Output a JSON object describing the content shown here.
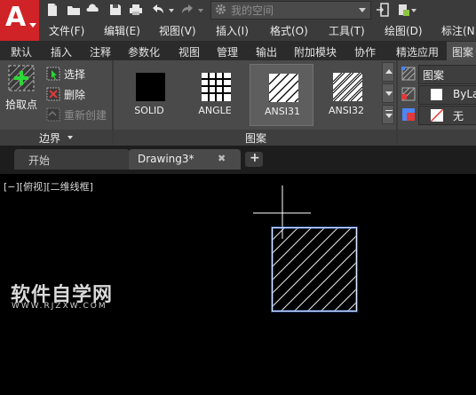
{
  "app": {
    "logo_letter": "A"
  },
  "search": {
    "placeholder": "我的空间"
  },
  "menu": [
    "文件(F)",
    "编辑(E)",
    "视图(V)",
    "插入(I)",
    "格式(O)",
    "工具(T)",
    "绘图(D)",
    "标注(N"
  ],
  "ribbon_tabs": [
    "默认",
    "插入",
    "注释",
    "参数化",
    "视图",
    "管理",
    "输出",
    "附加模块",
    "协作",
    "精选应用",
    "图案"
  ],
  "boundary_panel": {
    "pick_point_label": "拾取点",
    "select_label": "选择",
    "delete_label": "删除",
    "recreate_label": "重新创建",
    "title": "边界"
  },
  "pattern_panel": {
    "title": "图案",
    "items": [
      {
        "name": "SOLID",
        "selected": false
      },
      {
        "name": "ANGLE",
        "selected": false
      },
      {
        "name": "ANSI31",
        "selected": true
      },
      {
        "name": "ANSI32",
        "selected": false
      }
    ]
  },
  "properties_panel": {
    "type_value": "图案",
    "color_value": "ByLa",
    "background_value": "无"
  },
  "file_tabs": {
    "start": "开始",
    "drawing": "Drawing3*",
    "close_glyph": "✖",
    "add_glyph": "+"
  },
  "viewport": {
    "label": "[−][俯视][二维线框]"
  },
  "watermark": {
    "main": "软件自学网",
    "sub": "WWW.RJZXW.COM"
  },
  "colors": {
    "logo_red": "#cf2328",
    "selection_blue": "#4c86f5",
    "ribbon_bg": "#4a4a4a"
  }
}
